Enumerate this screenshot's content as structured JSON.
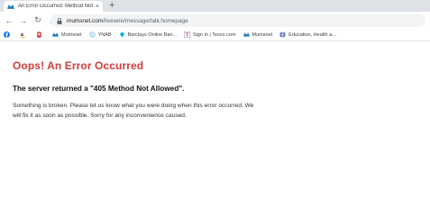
{
  "tab": {
    "title": "An Error Occurred: Method Not A",
    "close_glyph": "×",
    "new_tab_glyph": "+"
  },
  "toolbar": {
    "back_glyph": "←",
    "forward_glyph": "→",
    "reload_glyph": "↻",
    "home_glyph": "⌂",
    "url_host": "mumsnet.com",
    "url_path": "/livewire/message/talk.homepage"
  },
  "bookmarks": [
    {
      "label": "",
      "icon": "facebook-icon",
      "color": "#1877f2"
    },
    {
      "label": "",
      "icon": "amazon-icon",
      "color": "#222222"
    },
    {
      "label": "",
      "icon": "bookmark-icon-red",
      "color": "#c62828"
    },
    {
      "label": "Mumsnet",
      "icon": "mumsnet-icon",
      "color": "#2a7ab8"
    },
    {
      "label": "YNAB",
      "icon": "ynab-icon",
      "color": "#85c3e9"
    },
    {
      "label": "Barclays Online Ban...",
      "icon": "barclays-icon",
      "color": "#00aeef"
    },
    {
      "label": "Sign in | Tesco.com",
      "icon": "tesco-icon",
      "color": "#ee1c2e"
    },
    {
      "label": "Mumsnet",
      "icon": "mumsnet-icon",
      "color": "#2a7ab8"
    },
    {
      "label": "Education, Health a...",
      "icon": "globe-icon",
      "color": "#4a5ea8"
    }
  ],
  "page": {
    "title": "Oops! An Error Occurred",
    "subtitle": "The server returned a \"405 Method Not Allowed\".",
    "message": "Something is broken. Please let us know what you were doing when this error occurred. We will fix it as soon as possible. Sorry for any inconvenience caused."
  }
}
